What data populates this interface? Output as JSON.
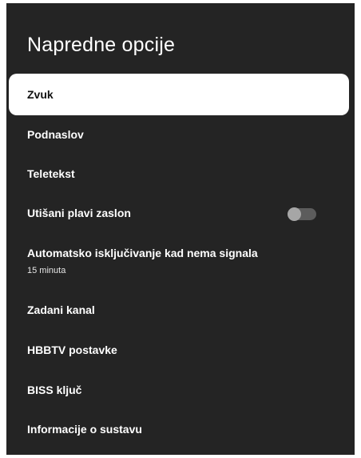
{
  "page": {
    "title": "Napredne opcije"
  },
  "menu": {
    "items": [
      {
        "label": "Zvuk",
        "selected": true
      },
      {
        "label": "Podnaslov"
      },
      {
        "label": "Teletekst"
      },
      {
        "label": "Utišani plavi zaslon",
        "toggle": "off"
      },
      {
        "label": "Automatsko isključivanje kad nema signala",
        "sublabel": "15 minuta"
      },
      {
        "label": "Zadani kanal"
      },
      {
        "label": "HBBTV postavke"
      },
      {
        "label": "BISS ključ"
      },
      {
        "label": "Informacije o sustavu"
      }
    ]
  },
  "colors": {
    "panel_background": "#242424",
    "selected_background": "#ffffff",
    "text": "#ffffff",
    "selected_text": "#111111",
    "toggle_track_off": "#5c5c5c",
    "toggle_knob_off": "#a6a6a6"
  }
}
